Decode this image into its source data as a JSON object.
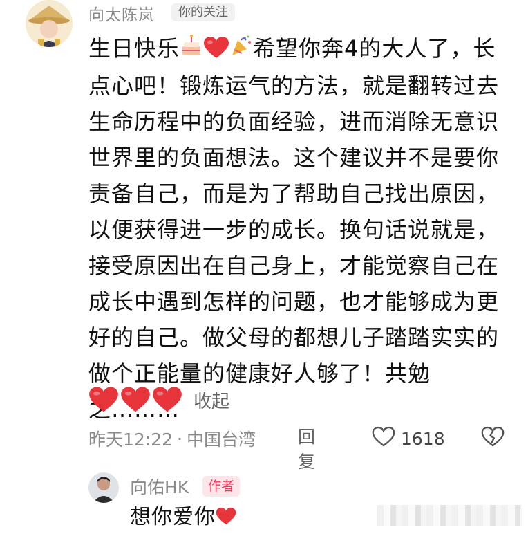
{
  "comment": {
    "author_name": "向太陈岚",
    "follow_badge": "你的关注",
    "text_part1": "生日快乐",
    "text_part2": "希望你奔4的大人了，长点心吧！锻炼运气的方法，就是翻转过去生命历程中的负面经验，进而消除无意识世界里的负面想法。这个建议并不是要你责备自己，而是为了帮助自己找出原因，以便获得进一步的成长。换句话说就是，接受原因出在自己身上，才能觉察自己在成长中遇到怎样的问题，也才能够成为更好的自己。做父母的都想儿子踏踏实实的做个正能量的健康好人够了！共勉之………",
    "collapse_label": "收起",
    "time": "昨天12:22",
    "location": "中国台湾",
    "reply_label": "回复",
    "like_count": "1618"
  },
  "reply": {
    "author_name": "向佑HK",
    "author_badge": "作者",
    "text": "想你爱你"
  },
  "colors": {
    "heart_red": "#e8343b",
    "badge_pink": "#ff3355",
    "meta_gray": "#8a8a8a"
  },
  "icons": [
    "birthday-cake-icon",
    "red-heart-icon",
    "party-popper-icon",
    "like-heart-outline-icon",
    "broken-heart-icon"
  ]
}
